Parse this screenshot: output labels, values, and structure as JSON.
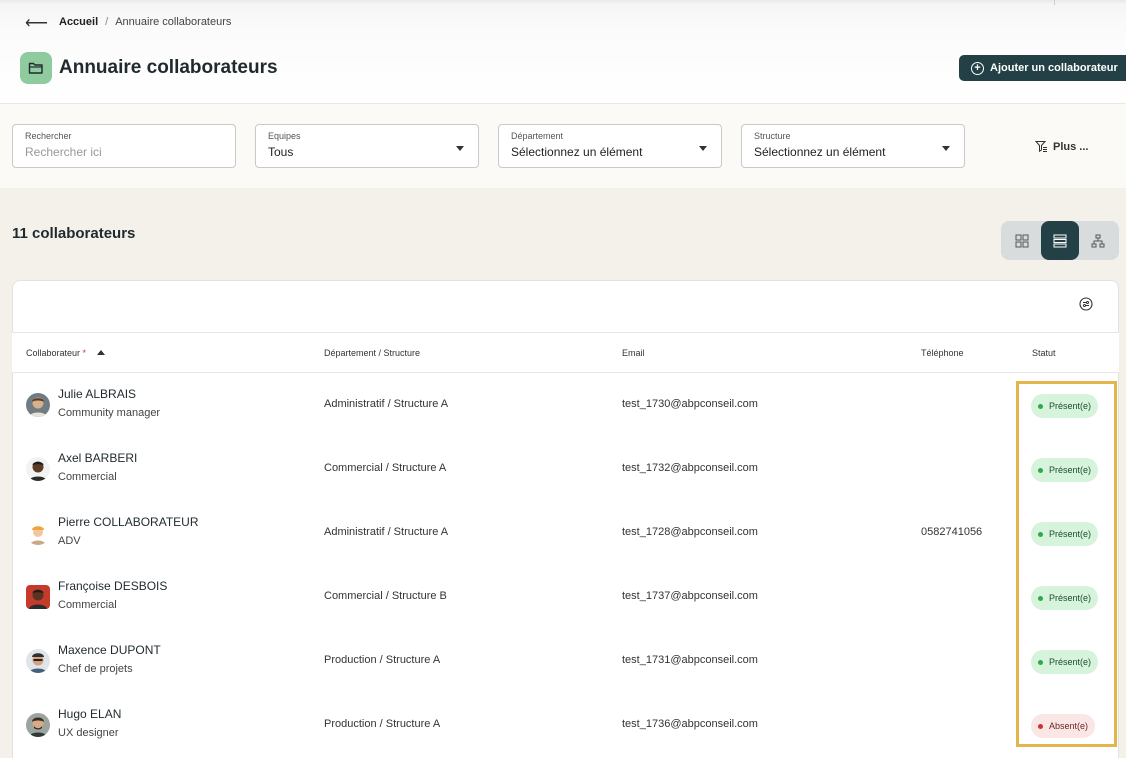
{
  "breadcrumb": {
    "home": "Accueil",
    "separator": "/",
    "current": "Annuaire collaborateurs"
  },
  "page": {
    "title": "Annuaire collaborateurs",
    "icon": "folder-icon",
    "icon_bg": "#8fcb9e"
  },
  "actions": {
    "add_label": "Ajouter un collaborateur"
  },
  "filters": {
    "search": {
      "label": "Rechercher",
      "placeholder": "Rechercher ici"
    },
    "teams": {
      "label": "Equipes",
      "value": "Tous"
    },
    "department": {
      "label": "Département",
      "value": "Sélectionnez un élément"
    },
    "structure": {
      "label": "Structure",
      "value": "Sélectionnez un élément"
    },
    "more_label": "Plus ..."
  },
  "summary": {
    "count_label": "11 collaborateurs"
  },
  "view_modes": {
    "items": [
      "grid-view-icon",
      "list-view-icon",
      "org-chart-icon"
    ],
    "active": "list-view-icon"
  },
  "table": {
    "columns": {
      "collaborator": "Collaborateur",
      "required_mark": "*",
      "department": "Département / Structure",
      "email": "Email",
      "phone": "Téléphone",
      "status": "Statut"
    },
    "rows": [
      {
        "name": "Julie ALBRAIS",
        "role": "Community manager",
        "department": "Administratif / Structure A",
        "email": "test_1730@abpconseil.com",
        "phone": "",
        "status": "Présent(e)"
      },
      {
        "name": "Axel BARBERI",
        "role": "Commercial",
        "department": "Commercial / Structure A",
        "email": "test_1732@abpconseil.com",
        "phone": "",
        "status": "Présent(e)"
      },
      {
        "name": "Pierre COLLABORATEUR",
        "role": "ADV",
        "department": "Administratif / Structure A",
        "email": "test_1728@abpconseil.com",
        "phone": "0582741056",
        "status": "Présent(e)"
      },
      {
        "name": "Françoise DESBOIS",
        "role": "Commercial",
        "department": "Commercial / Structure B",
        "email": "test_1737@abpconseil.com",
        "phone": "",
        "status": "Présent(e)"
      },
      {
        "name": "Maxence DUPONT",
        "role": "Chef de projets",
        "department": "Production / Structure A",
        "email": "test_1731@abpconseil.com",
        "phone": "",
        "status": "Présent(e)"
      },
      {
        "name": "Hugo ELAN",
        "role": "UX designer",
        "department": "Production / Structure A",
        "email": "test_1736@abpconseil.com",
        "phone": "",
        "status": "Absent(e)"
      }
    ]
  },
  "colors": {
    "primary": "#234046",
    "present": "#2faa4a",
    "absent": "#d32f2f",
    "highlight": "#e2b64a"
  }
}
